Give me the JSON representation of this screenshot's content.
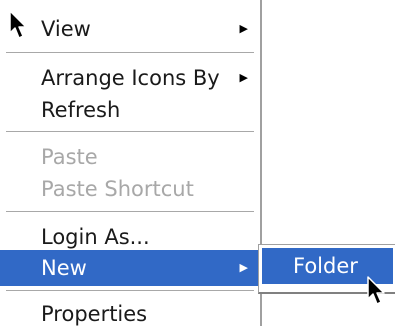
{
  "context_menu": {
    "items": [
      {
        "label": "View",
        "has_submenu": true
      },
      {
        "label": "Arrange Icons By",
        "has_submenu": true
      },
      {
        "label": "Refresh"
      },
      {
        "label": "Paste",
        "disabled": true
      },
      {
        "label": "Paste Shortcut",
        "disabled": true
      },
      {
        "label": "Login As..."
      },
      {
        "label": "New",
        "has_submenu": true,
        "highlighted": true
      },
      {
        "label": "Properties"
      }
    ],
    "submenu_arrow": "▶"
  },
  "new_submenu": {
    "items": [
      {
        "label": "Folder",
        "highlighted": true
      }
    ]
  },
  "icons": {
    "mouse_pointer": "arrow-cursor-icon"
  },
  "colors": {
    "highlight": "#3169c6",
    "highlight_text": "#ffffff",
    "disabled_text": "#a8a8a8",
    "menu_border": "#a0a0a0"
  }
}
